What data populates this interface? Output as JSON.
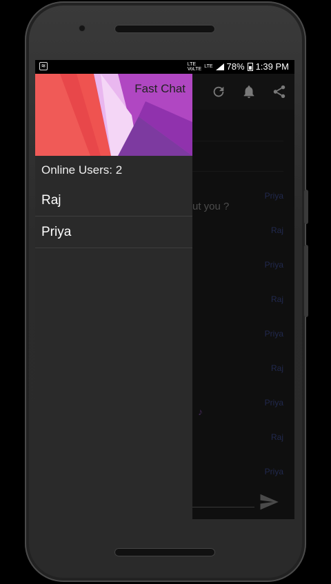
{
  "status_bar": {
    "network_top": "LTE",
    "network_bottom": "VoLTE",
    "lte2": "LTE",
    "battery_percent": "78%",
    "time": "1:39 PM",
    "notification_icon": "wifi-hotspot-icon"
  },
  "toolbar": {
    "icons": [
      "refresh-icon",
      "bell-icon",
      "share-icon"
    ]
  },
  "drawer": {
    "header_title": "Fast Chat",
    "online_label": "Online Users: 2",
    "users": [
      {
        "name": "Raj"
      },
      {
        "name": "Priya"
      }
    ]
  },
  "chat_behind": {
    "senders": [
      "Priya",
      "Raj",
      "Priya",
      "Raj",
      "Priya",
      "Raj",
      "Priya",
      "Raj",
      "Priya"
    ],
    "partial_text": "ut you ?",
    "note_glyph": "♪"
  },
  "composer": {
    "send_icon": "send-icon"
  },
  "colors": {
    "header_red": "#ef5350",
    "header_purple": "#a43bb5",
    "sender_blue": "#3c4a8c"
  }
}
